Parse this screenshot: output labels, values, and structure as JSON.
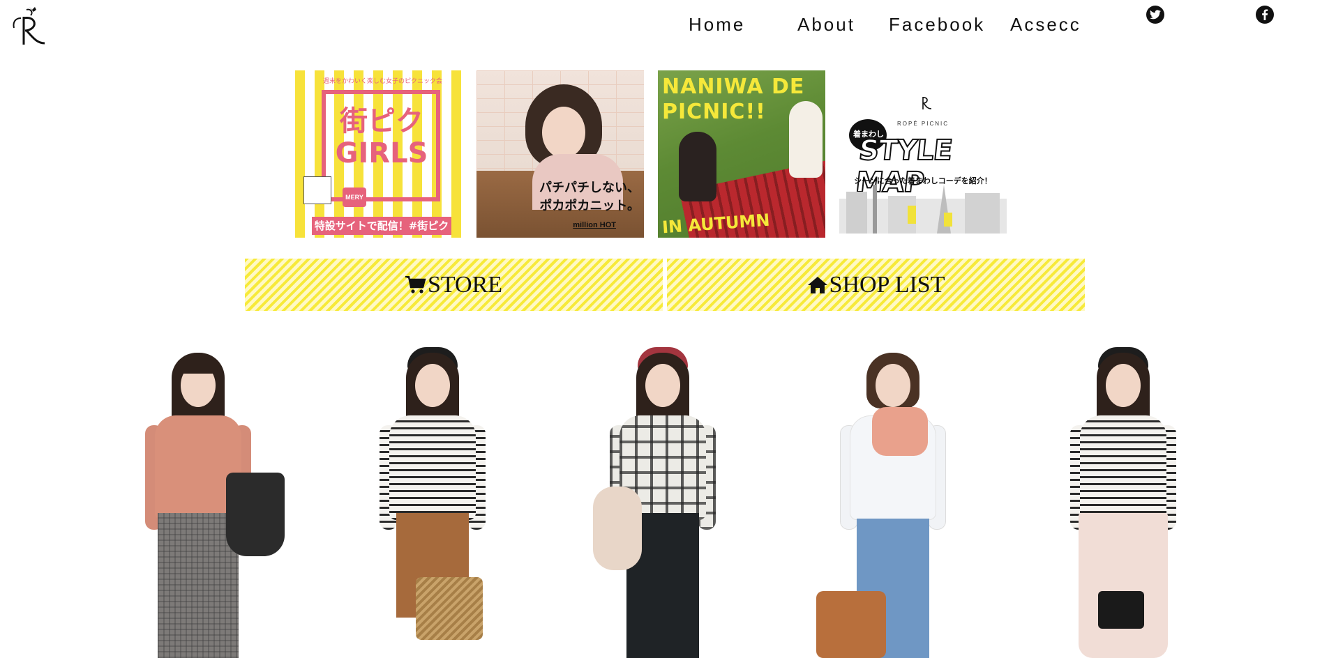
{
  "header": {
    "logo_alt": "R"
  },
  "nav": {
    "home": "Home",
    "about": "About",
    "facebook": "Facebook",
    "acsecc": "Acsecc"
  },
  "social": {
    "twitter_icon": "twitter-icon",
    "facebook_icon": "facebook-icon"
  },
  "banners": [
    {
      "id": "machipiku-girls",
      "top_text": "週末をかわいく楽しむ女子のピクニック会",
      "title": "街ピクGIRLS",
      "footer": "特設サイトで配信！#街ピク",
      "badge": "MERY"
    },
    {
      "id": "million-hot",
      "text_line1": "パチパチしない、",
      "text_line2": "ポカポカニット。",
      "brand": "million HOT"
    },
    {
      "id": "naniwa-picnic",
      "text_line1": "NANIWA DE",
      "text_line2": "PICNIC!!",
      "footer": "IN AUTUMN"
    },
    {
      "id": "style-map",
      "brand": "ROPÉ PICNIC",
      "bubble": "着まわし",
      "title": "STYLE MAP",
      "subtitle": "シーンに合った着まわしコーデを紹介！"
    }
  ],
  "buttons": {
    "store": "STORE",
    "shop_list": "SHOP LIST"
  },
  "colors": {
    "accent_yellow": "#f7ea3a",
    "text": "#111111",
    "banner_pink": "#e6627c"
  },
  "models": [
    {
      "outfit": "pink-blouse-check-pants"
    },
    {
      "outfit": "stripe-top-brown-skirt"
    },
    {
      "outfit": "plaid-top-black-skirt"
    },
    {
      "outfit": "white-shirt-denim"
    },
    {
      "outfit": "stripe-top-pink-skirt"
    }
  ]
}
